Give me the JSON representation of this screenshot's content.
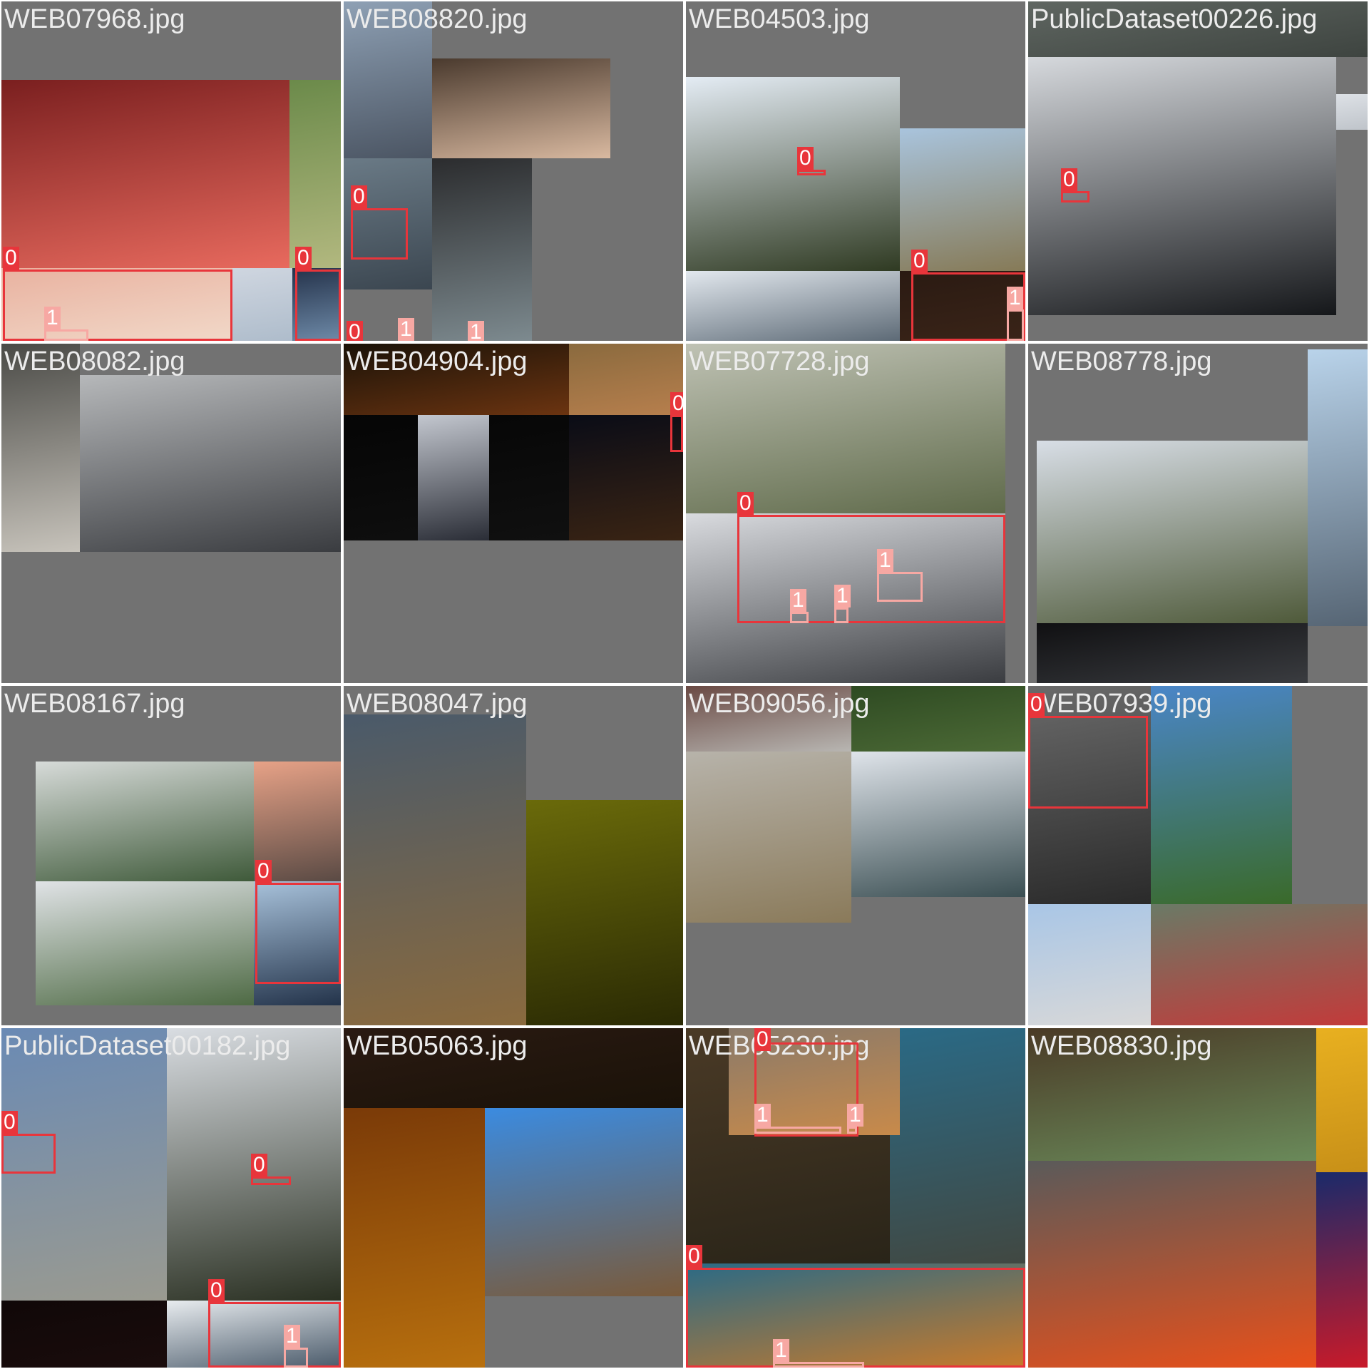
{
  "grid": {
    "classes": {
      "0": "#e8353b",
      "1": "#f7a8a3"
    },
    "cells": [
      {
        "title": "WEB07968.jpg",
        "tiles": [
          {
            "r": [
              0,
              110,
              404,
              264
            ],
            "c": "#7a1f1f,#e86a5e"
          },
          {
            "r": [
              404,
              110,
              72,
              264
            ],
            "c": "#6b8a4a,#b2b87f"
          },
          {
            "r": [
              0,
              374,
              324,
              102
            ],
            "c": "#e9b2a0,#f1d8c8"
          },
          {
            "r": [
              324,
              374,
              84,
              102
            ],
            "c": "#cfd6e0,#aebccb"
          },
          {
            "r": [
              408,
              374,
              68,
              102
            ],
            "c": "#24324a,#6e8aa8"
          }
        ],
        "boxes": [
          {
            "cls": "0",
            "r": [
              2,
              376,
              322,
              100
            ]
          },
          {
            "cls": "0",
            "r": [
              412,
              376,
              64,
              100
            ]
          },
          {
            "cls": "1",
            "r": [
              60,
              460,
              62,
              16
            ]
          }
        ]
      },
      {
        "title": "WEB08820.jpg",
        "tiles": [
          {
            "r": [
              0,
              0,
              124,
              220
            ],
            "c": "#8ea0b4,#4b5563"
          },
          {
            "r": [
              124,
              80,
              250,
              140
            ],
            "c": "#4a3a2e,#d9b9a0"
          },
          {
            "r": [
              0,
              220,
              124,
              184
            ],
            "c": "#6a7a86,#3b4650"
          },
          {
            "r": [
              124,
              220,
              140,
              256
            ],
            "c": "#2b2c2e,#7d8a8f"
          }
        ],
        "boxes": [
          {
            "cls": "0",
            "r": [
              10,
              290,
              80,
              72
            ]
          },
          {
            "cls": "0",
            "r": [
              4,
              480,
              282,
              24
            ]
          },
          {
            "cls": "1",
            "r": [
              76,
              476,
              16,
              28
            ]
          },
          {
            "cls": "1",
            "r": [
              174,
              480,
              16,
              24
            ]
          }
        ]
      },
      {
        "title": "WEB04503.jpg",
        "tiles": [
          {
            "r": [
              0,
              106,
              300,
              272
            ],
            "c": "#e4ecf4,#2f3a22"
          },
          {
            "r": [
              300,
              178,
              176,
              200
            ],
            "c": "#a9c4dd,#867a57"
          },
          {
            "r": [
              0,
              378,
              300,
              98
            ],
            "c": "#e2e8ee,#5d6a76"
          },
          {
            "r": [
              300,
              378,
              176,
              98
            ],
            "c": "#2a1a12,#3a2418"
          }
        ],
        "boxes": [
          {
            "cls": "0",
            "r": [
              156,
              236,
              40,
              8
            ]
          },
          {
            "cls": "0",
            "r": [
              316,
              380,
              160,
              96
            ]
          },
          {
            "cls": "1",
            "r": [
              450,
              432,
              24,
              44
            ]
          }
        ]
      },
      {
        "title": "PublicDataset00226.jpg",
        "tiles": [
          {
            "r": [
              0,
              0,
              476,
              78
            ],
            "c": "#5f6661,#3e4440"
          },
          {
            "r": [
              0,
              78,
              432,
              362
            ],
            "c": "#d6d9dd,#15171a"
          },
          {
            "r": [
              432,
              130,
              44,
              50
            ],
            "c": "#dde1e6,#bfc4ca"
          }
        ],
        "boxes": [
          {
            "cls": "0",
            "r": [
              46,
              266,
              40,
              16
            ]
          }
        ]
      },
      {
        "title": "WEB08082.jpg",
        "tiles": [
          {
            "r": [
              0,
              0,
              110,
              292
            ],
            "c": "#4a4a46,#c7c3bb"
          },
          {
            "r": [
              110,
              44,
              366,
              248
            ],
            "c": "#b6b8ba,#3a3c40"
          }
        ],
        "boxes": []
      },
      {
        "title": "WEB04904.jpg",
        "tiles": [
          {
            "r": [
              0,
              0,
              476,
              100
            ],
            "c": "#1a1208,#7a3a12"
          },
          {
            "r": [
              316,
              0,
              160,
              100
            ],
            "c": "#8a6a3e,#b77f4d"
          },
          {
            "r": [
              316,
              100,
              160,
              176
            ],
            "c": "#0a0c16,#3a2414"
          },
          {
            "r": [
              0,
              100,
              316,
              176
            ],
            "c": "#050505,#101010"
          },
          {
            "r": [
              104,
              100,
              100,
              176
            ],
            "c": "#c3c7cf,#2a2d36"
          }
        ],
        "boxes": [
          {
            "cls": "0",
            "r": [
              458,
              100,
              18,
              52
            ]
          }
        ]
      },
      {
        "title": "WEB07728.jpg",
        "tiles": [
          {
            "r": [
              0,
              0,
              448,
              238
            ],
            "c": "#bfc2b4,#5f6a4a"
          },
          {
            "r": [
              0,
              238,
              448,
              238
            ],
            "c": "#d9dbdf,#3a3c40"
          }
        ],
        "boxes": [
          {
            "cls": "0",
            "r": [
              72,
              240,
              376,
              152
            ]
          },
          {
            "cls": "1",
            "r": [
              268,
              320,
              64,
              42
            ]
          },
          {
            "cls": "1",
            "r": [
              146,
              376,
              26,
              16
            ]
          },
          {
            "cls": "1",
            "r": [
              208,
              370,
              20,
              22
            ]
          }
        ]
      },
      {
        "title": "WEB08778.jpg",
        "tiles": [
          {
            "r": [
              392,
              8,
              84,
              388
            ],
            "c": "#b9d3ea,#566574"
          },
          {
            "r": [
              12,
              136,
              380,
              256
            ],
            "c": "#d8dee6,#4f5a3a"
          },
          {
            "r": [
              12,
              392,
              380,
              84
            ],
            "c": "#101012,#3a3c40"
          }
        ],
        "boxes": []
      },
      {
        "title": "WEB08167.jpg",
        "tiles": [
          {
            "r": [
              48,
              106,
              306,
              168
            ],
            "c": "#d7dbd9,#3f5a3a"
          },
          {
            "r": [
              354,
              106,
              122,
              168
            ],
            "c": "#e7a287,#5a4a44"
          },
          {
            "r": [
              48,
              274,
              306,
              174
            ],
            "c": "#e0e3e6,#4e6a44"
          },
          {
            "r": [
              354,
              274,
              122,
              174
            ],
            "c": "#a8c2db,#23334a"
          }
        ],
        "boxes": [
          {
            "cls": "0",
            "r": [
              356,
              276,
              120,
              142
            ]
          }
        ]
      },
      {
        "title": "WEB08047.jpg",
        "tiles": [
          {
            "r": [
              0,
              40,
              256,
              436
            ],
            "c": "#4a5a6a,#8a6a3e"
          },
          {
            "r": [
              256,
              160,
              220,
              316
            ],
            "c": "#6a6a0a,#2a2a04"
          }
        ],
        "boxes": []
      },
      {
        "title": "WEB09056.jpg",
        "tiles": [
          {
            "r": [
              0,
              0,
              232,
              92
            ],
            "c": "#6a4a44,#b8b6b2"
          },
          {
            "r": [
              232,
              0,
              244,
              92
            ],
            "c": "#2e4a22,#4c6a36"
          },
          {
            "r": [
              0,
              92,
              232,
              240
            ],
            "c": "#b7b3aa,#8a7a5a"
          },
          {
            "r": [
              232,
              92,
              244,
              204
            ],
            "c": "#dfe4ea,#3a4e52"
          }
        ],
        "boxes": []
      },
      {
        "title": "WEB07939.jpg",
        "tiles": [
          {
            "r": [
              0,
              0,
              172,
              306
            ],
            "c": "#6a6a6a,#2a2a2a"
          },
          {
            "r": [
              172,
              0,
              198,
              306
            ],
            "c": "#4a86c8,#3a6a2a"
          },
          {
            "r": [
              0,
              306,
              172,
              170
            ],
            "c": "#a9c6e6,#d8d8d8"
          },
          {
            "r": [
              172,
              306,
              304,
              170
            ],
            "c": "#6a7a66,#c33a3a"
          }
        ],
        "boxes": [
          {
            "cls": "0",
            "r": [
              0,
              42,
              168,
              130
            ]
          }
        ]
      },
      {
        "title": "PublicDataset00182.jpg",
        "tiles": [
          {
            "r": [
              0,
              0,
              232,
              382
            ],
            "c": "#6a8ab4,#9a9a90"
          },
          {
            "r": [
              232,
              0,
              244,
              382
            ],
            "c": "#d9dde2,#2a3022"
          },
          {
            "r": [
              0,
              382,
              232,
              94
            ],
            "c": "#100808,#1a0c0c"
          },
          {
            "r": [
              232,
              382,
              244,
              94
            ],
            "c": "#e8ecef,#4a5a6a"
          }
        ],
        "boxes": [
          {
            "cls": "0",
            "r": [
              0,
              148,
              76,
              56
            ]
          },
          {
            "cls": "0",
            "r": [
              350,
              208,
              56,
              12
            ]
          },
          {
            "cls": "0",
            "r": [
              290,
              384,
              186,
              92
            ]
          },
          {
            "cls": "1",
            "r": [
              396,
              448,
              34,
              28
            ]
          }
        ]
      },
      {
        "title": "WEB05063.jpg",
        "tiles": [
          {
            "r": [
              0,
              0,
              476,
              112
            ],
            "c": "#2a1a12,#1a1208"
          },
          {
            "r": [
              0,
              112,
              198,
              364
            ],
            "c": "#7a3a08,#b8700e"
          },
          {
            "r": [
              198,
              112,
              278,
              264
            ],
            "c": "#3b8be0,#7a5a3a"
          }
        ],
        "boxes": []
      },
      {
        "title": "WEB05230.jpg",
        "tiles": [
          {
            "r": [
              0,
              0,
              476,
              476
            ],
            "c": "#4a3a26,#1a1a12"
          },
          {
            "r": [
              286,
              0,
              190,
              476
            ],
            "c": "#2a6a86,#4a3a26"
          },
          {
            "r": [
              60,
              0,
              240,
              150
            ],
            "c": "#8a7a6a,#c88a4a"
          },
          {
            "r": [
              0,
              330,
              476,
              146
            ],
            "c": "#2a6a86,#c87a2a"
          }
        ],
        "boxes": [
          {
            "cls": "0",
            "r": [
              96,
              20,
              146,
              132
            ]
          },
          {
            "cls": "1",
            "r": [
              96,
              138,
              122,
              10
            ]
          },
          {
            "cls": "1",
            "r": [
              226,
              138,
              14,
              10
            ]
          },
          {
            "cls": "0",
            "r": [
              0,
              336,
              476,
              140
            ]
          },
          {
            "cls": "1",
            "r": [
              122,
              468,
              128,
              8
            ]
          }
        ]
      },
      {
        "title": "WEB08830.jpg",
        "tiles": [
          {
            "r": [
              0,
              0,
              404,
              186
            ],
            "c": "#4a3a26,#6a8a5a"
          },
          {
            "r": [
              404,
              0,
              72,
              202
            ],
            "c": "#e8b020,#c89018"
          },
          {
            "r": [
              0,
              186,
              404,
              290
            ],
            "c": "#5a5a5a,#e8501a"
          },
          {
            "r": [
              404,
              202,
              72,
              274
            ],
            "c": "#1a2a6a,#c81a2a"
          }
        ],
        "boxes": []
      }
    ]
  }
}
